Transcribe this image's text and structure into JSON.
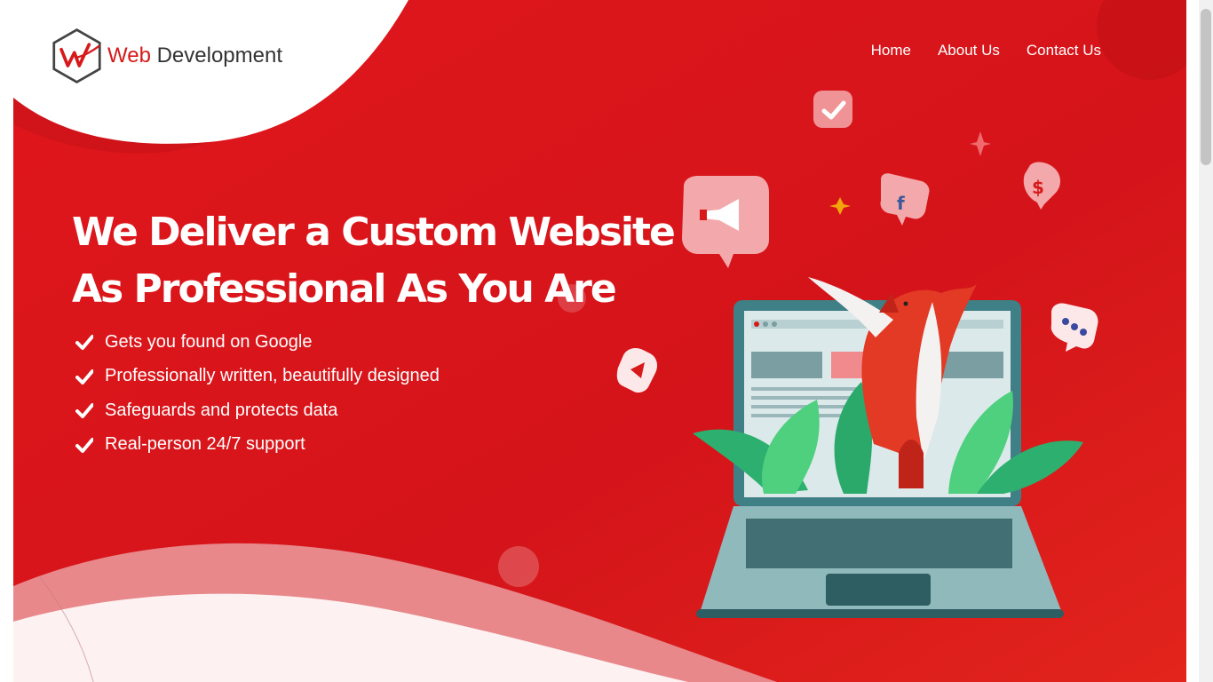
{
  "brand": {
    "name_part1": "Web",
    "name_part2": " Development",
    "logo_icon": "hexagon-w-logo-icon",
    "accent_color": "#d7191a"
  },
  "nav": {
    "items": [
      {
        "label": "Home"
      },
      {
        "label": "About Us"
      },
      {
        "label": "Contact Us"
      }
    ]
  },
  "hero": {
    "headline_line1": "We Deliver a Custom Website",
    "headline_line2": "As Professional As You Are",
    "features": [
      {
        "text": "Gets you found on Google"
      },
      {
        "text": "Professionally written, beautifully designed"
      },
      {
        "text": "Safeguards and protects data"
      },
      {
        "text": "Real-person 24/7 support"
      }
    ],
    "background_color": "#d8161a",
    "illustration": "laptop-fox-illustration",
    "floating_icons": [
      "checkmark-bubble-icon",
      "megaphone-bubble-icon",
      "facebook-bubble-icon",
      "dollar-bubble-icon",
      "chat-dots-bubble-icon",
      "play-bubble-icon"
    ]
  }
}
